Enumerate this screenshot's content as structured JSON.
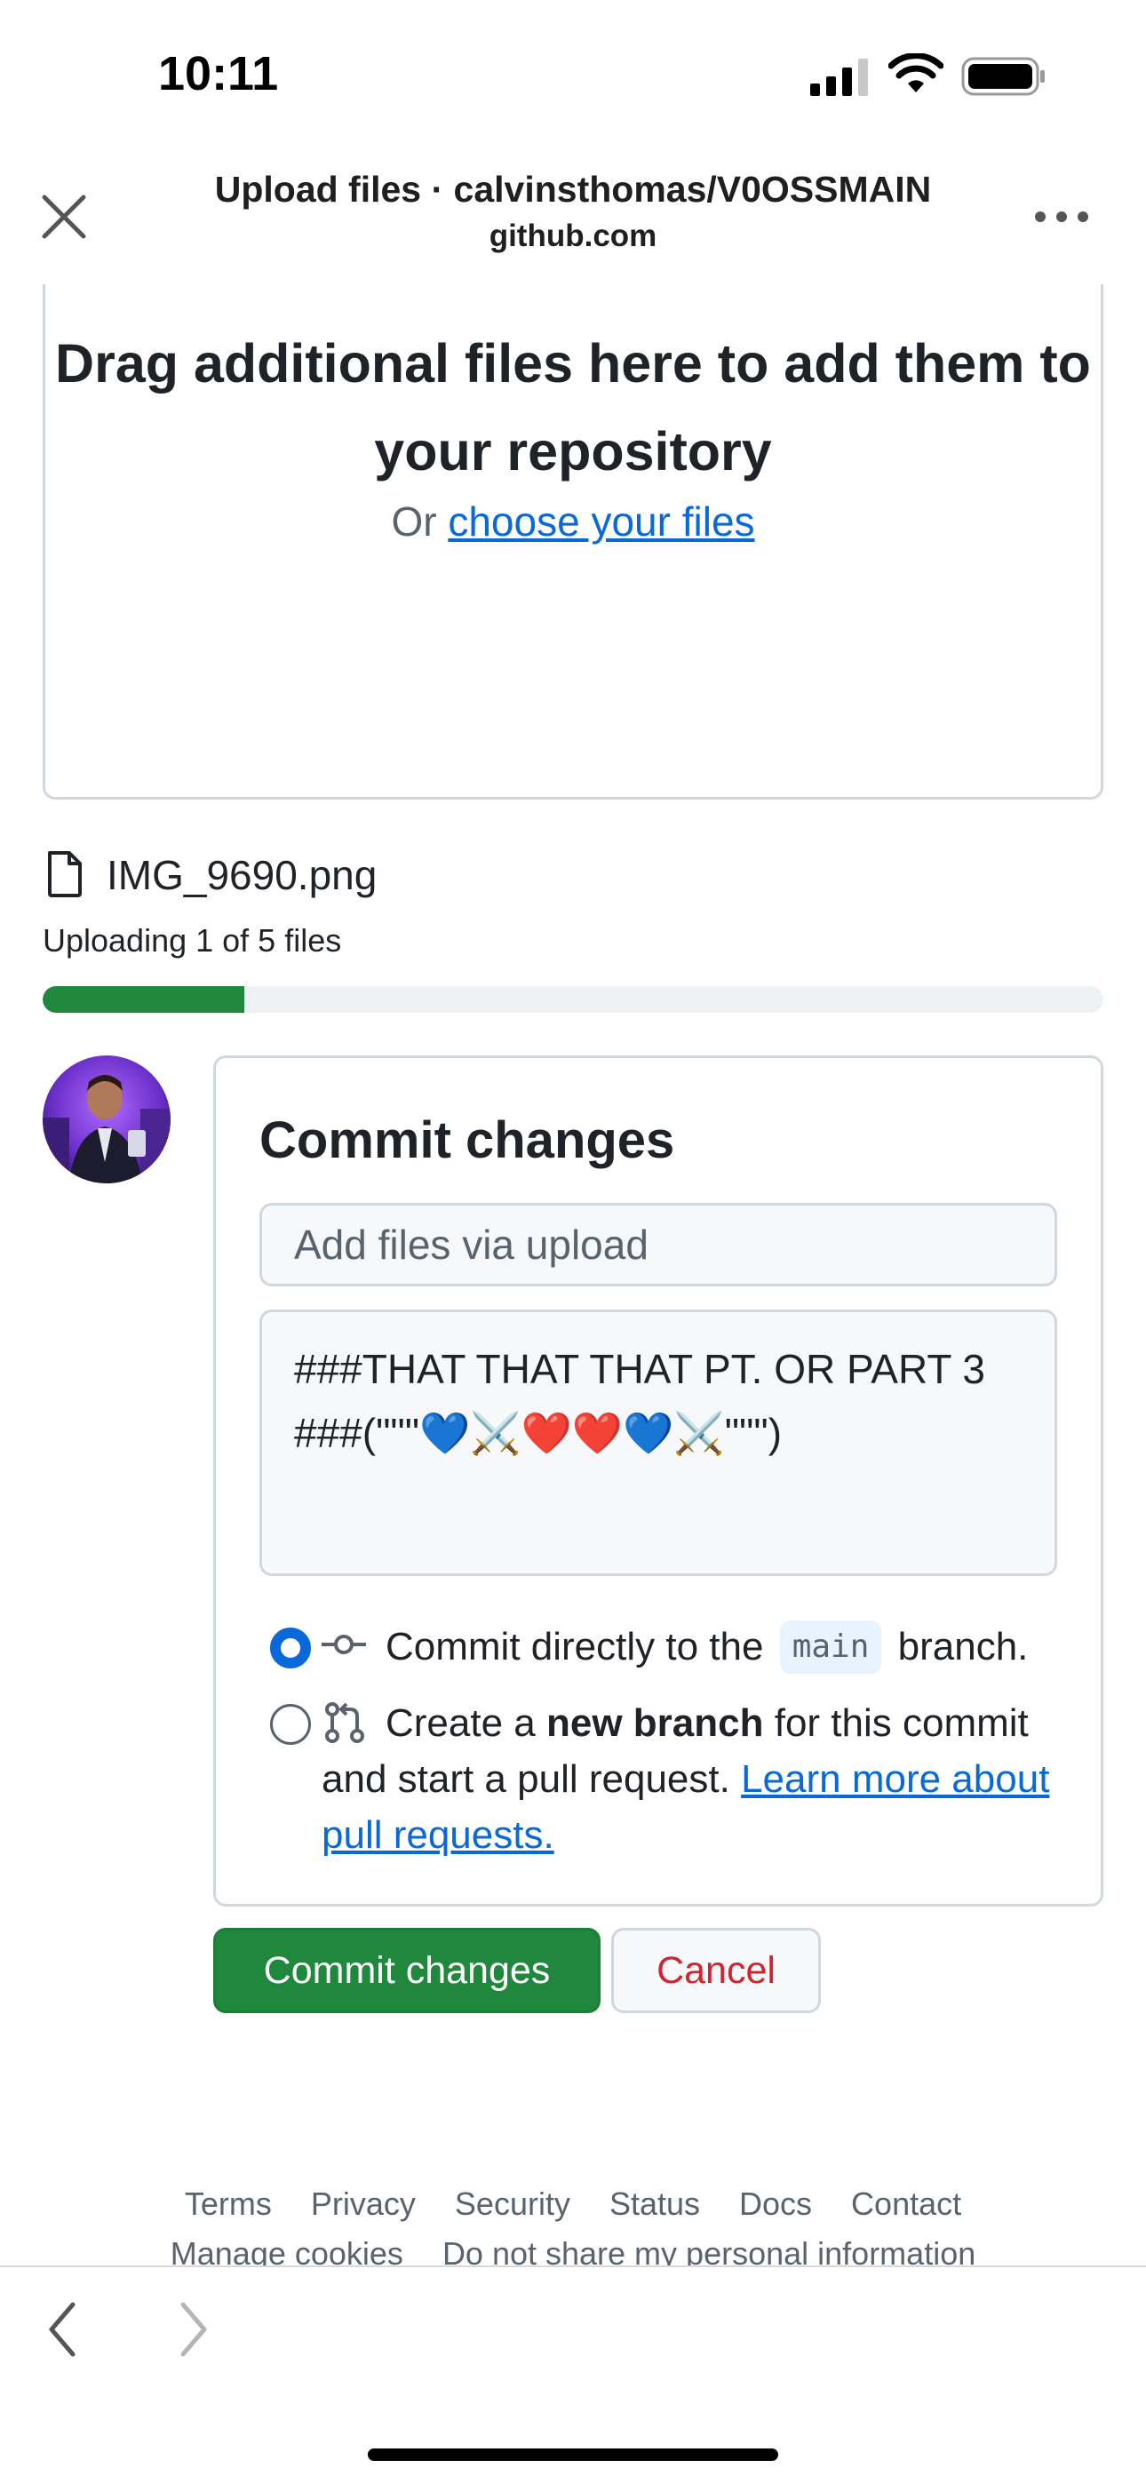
{
  "status_bar": {
    "time": "10:11"
  },
  "browser": {
    "title": "Upload files · calvinsthomas/V0OSSMAIN",
    "domain": "github.com"
  },
  "dropzone": {
    "title": "Drag additional files here to add them to your repository",
    "or_text": "Or",
    "choose_link": "choose your files"
  },
  "upload": {
    "file_name": "IMG_9690.png",
    "status": "Uploading 1 of 5 files",
    "progress": 0.19
  },
  "commit": {
    "title": "Commit changes",
    "summary_placeholder": "Add files via upload",
    "description_lines": [
      "###THAT THAT THAT PT. OR PART 3",
      "###(\"\"\"💙⚔️❤️❤️💙⚔️\"\"\")"
    ],
    "option_direct_prefix": "Commit directly to the",
    "branch_name": "main",
    "option_direct_suffix": "branch.",
    "option_new_prefix": "Create a",
    "option_new_bold": "new branch",
    "option_new_suffix": "for this commit and start a pull request.",
    "learn_more": "Learn more about pull requests.",
    "commit_button": "Commit changes",
    "cancel_button": "Cancel"
  },
  "footer": {
    "links": [
      "Terms",
      "Privacy",
      "Security",
      "Status",
      "Docs",
      "Contact"
    ],
    "links2": [
      "Manage cookies",
      "Do not share my personal information"
    ]
  },
  "colors": {
    "accent": "#0969da",
    "success": "#1f883d",
    "danger": "#d1242f"
  }
}
